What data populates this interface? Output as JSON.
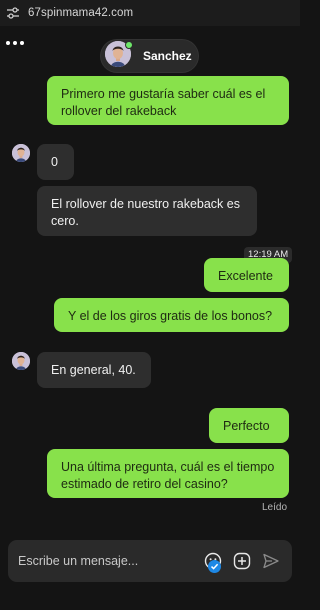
{
  "browser": {
    "url": "67spinmama42.com"
  },
  "header": {
    "agent_name": "Sanchez"
  },
  "messages": [
    {
      "from": "user",
      "text": "Primero me gustaría saber cuál es el rollover del rakeback"
    },
    {
      "from": "agent",
      "text": "0"
    },
    {
      "from": "agent",
      "text": "El rollover de nuestro rakeback es cero."
    },
    {
      "from": "user",
      "text": "Excelente"
    },
    {
      "from": "user",
      "text": "Y el de los giros gratis de los bonos?"
    },
    {
      "from": "agent",
      "text": "En general, 40."
    },
    {
      "from": "user",
      "text": "Perfecto"
    },
    {
      "from": "user",
      "text": "Una última pregunta, cuál es el tiempo estimado de retiro del casino?"
    }
  ],
  "timestamp": "12:19 AM",
  "read_receipt": "Leído",
  "composer": {
    "placeholder": "Escribe un mensaje..."
  },
  "colors": {
    "user_bubble": "#88e14b",
    "agent_bubble": "#2e2e2e",
    "background": "#141414",
    "online": "#6ee86a"
  }
}
